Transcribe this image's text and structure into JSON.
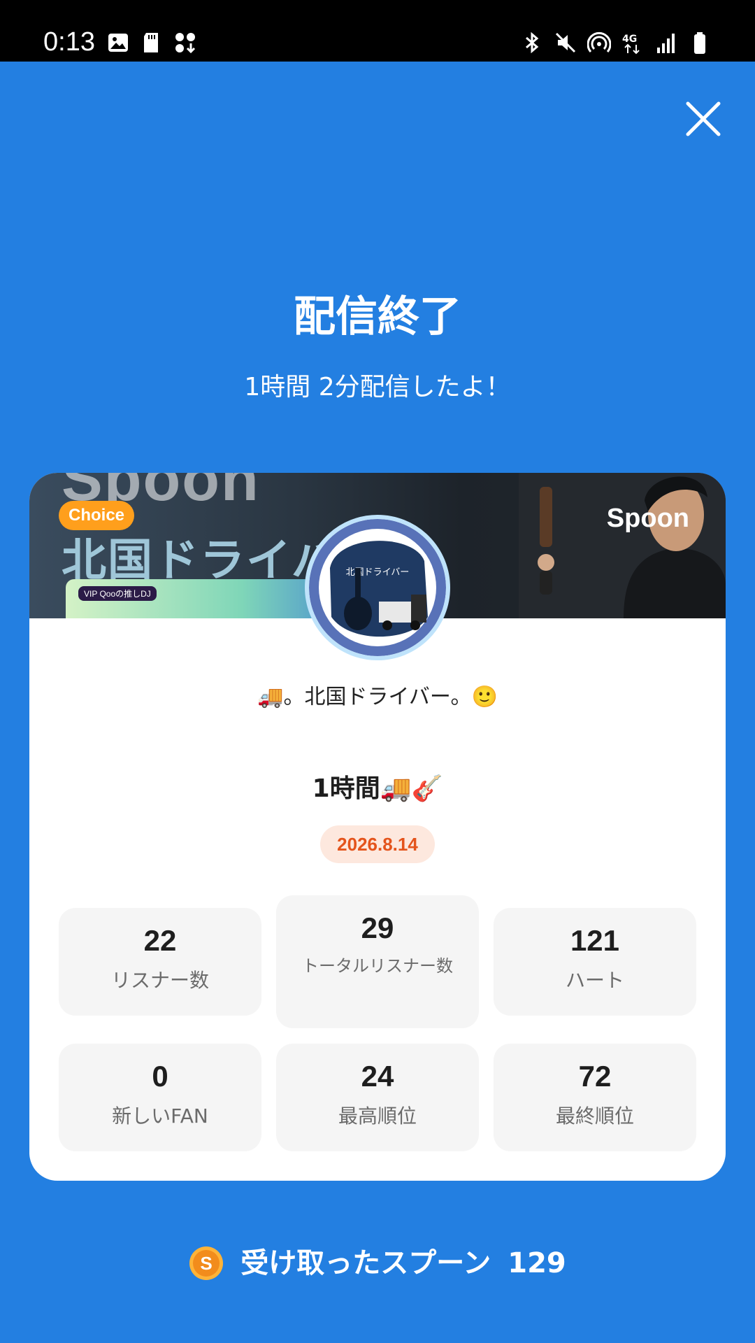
{
  "status_bar": {
    "time": "0:13",
    "left_icons": [
      "gallery-icon",
      "sd-card-icon",
      "app-icon"
    ],
    "right_icons": [
      "bluetooth-icon",
      "mute-icon",
      "hotspot-icon",
      "4g-icon",
      "signal-icon",
      "battery-icon"
    ]
  },
  "header": {
    "title": "配信終了",
    "subtitle": "1時間 2分配信したよ！"
  },
  "card": {
    "banner": {
      "background_word": "Spoon",
      "badge": "Choice",
      "kanji_text": "北国ドライバ",
      "mini_tag": "VIP Qooの推しDJ",
      "brand": "Spoon"
    },
    "avatar_text": "北国ドライバー",
    "dj_name": "🚚。北国ドライバー。🙂",
    "live_title": "1時間🚚🎸",
    "date": "2026.8.14",
    "stats": [
      {
        "value": "22",
        "label": "リスナー数"
      },
      {
        "value": "29",
        "label": "トータルリスナー数"
      },
      {
        "value": "121",
        "label": "ハート"
      },
      {
        "value": "0",
        "label": "新しいFAN"
      },
      {
        "value": "24",
        "label": "最高順位"
      },
      {
        "value": "72",
        "label": "最終順位"
      }
    ]
  },
  "footer": {
    "spoons_label": "受け取ったスプーン",
    "spoons_count": "129"
  },
  "colors": {
    "background": "#237fe1",
    "date_text": "#e4541c",
    "date_bg": "#fde8de",
    "badge": "#ff9f1c"
  }
}
